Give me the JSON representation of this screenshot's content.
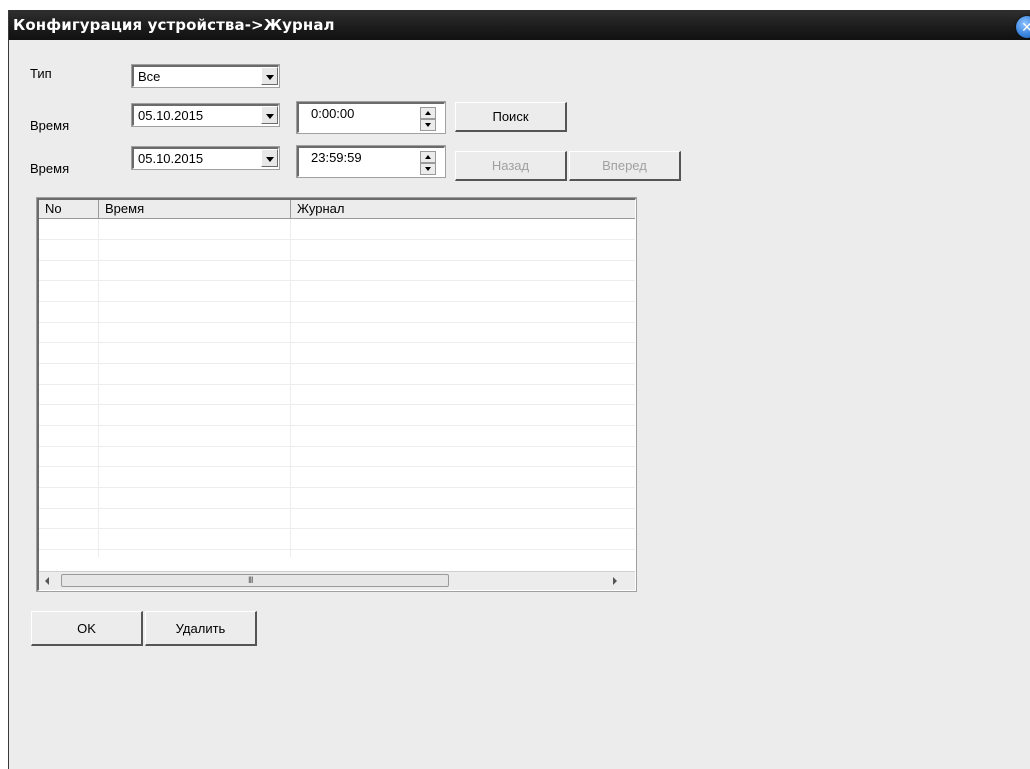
{
  "window": {
    "title": "Конфигурация устройства->Журнал",
    "close_glyph": "✕"
  },
  "filters": {
    "type_label": "Тип",
    "type_value": "Все",
    "start_label": "Время",
    "start_date": "05.10.2015",
    "start_time": "0:00:00",
    "end_label": "Время",
    "end_date": "05.10.2015",
    "end_time": "23:59:59"
  },
  "buttons": {
    "search": "Поиск",
    "back": "Назад",
    "forward": "Вперед",
    "ok": "OK",
    "delete": "Удалить"
  },
  "log_table": {
    "columns": [
      "No",
      "Время",
      "Журнал"
    ],
    "rows": []
  },
  "scrollbar": {
    "grip": "III"
  },
  "icons": {
    "close": "close-icon",
    "dropdown": "chevron-down-icon",
    "spin_up": "arrow-up-icon",
    "spin_down": "arrow-down-icon",
    "scroll_left": "arrow-left-icon",
    "scroll_right": "arrow-right-icon"
  },
  "colors": {
    "titlebar": "#1b1b1b",
    "background": "#ececec",
    "close_button": "#3b86e0",
    "disabled_text": "#a0a0a0"
  }
}
